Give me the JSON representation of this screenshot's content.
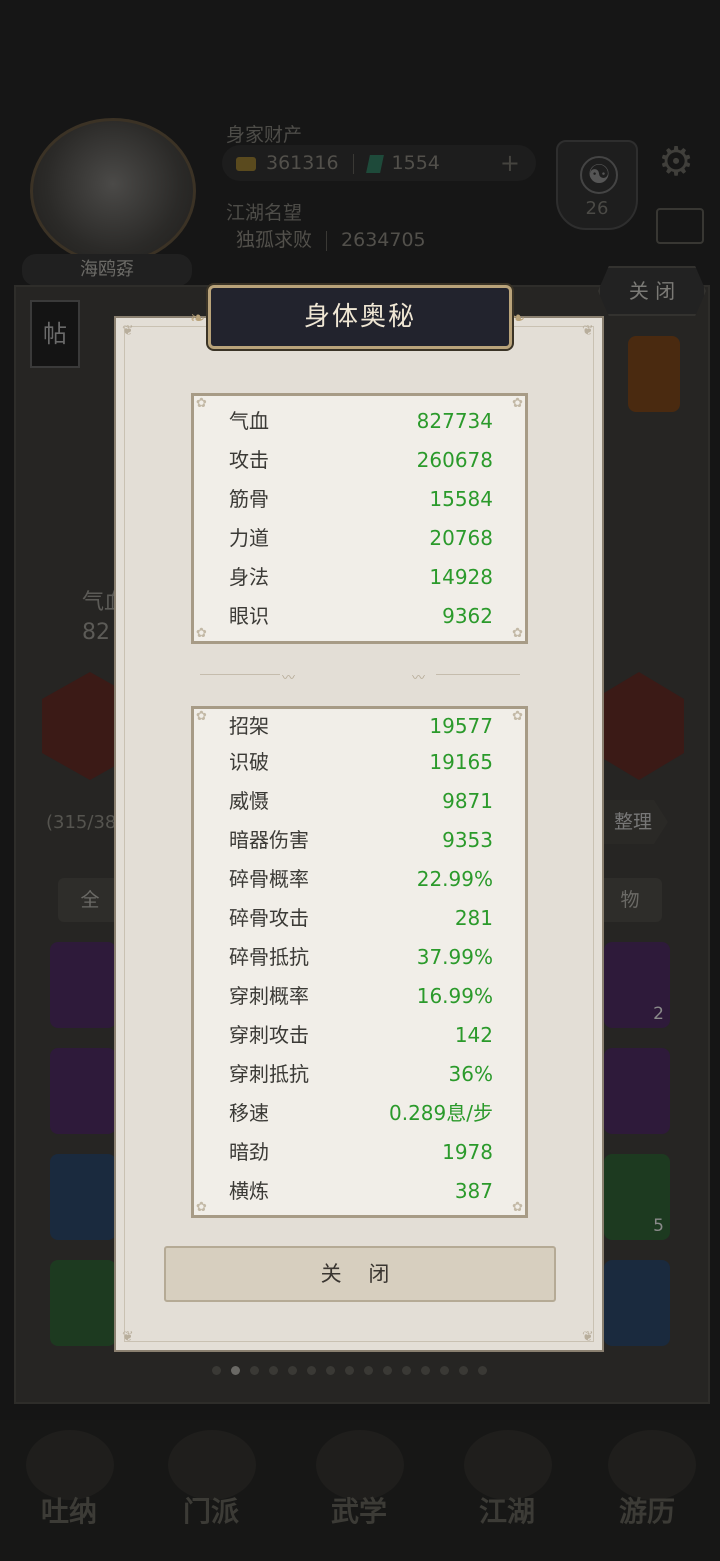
{
  "background": {
    "player_name": "海鸥孬",
    "wealth_label": "身家财产",
    "gold": "361316",
    "jade": "1554",
    "fame_label": "江湖名望",
    "title": "独孤求败",
    "fame_value": "2634705",
    "taiji_level": "26",
    "close_label": "关 闭",
    "post_label": "帖",
    "stat_label": "气血",
    "stat_value": "82",
    "capacity": "(315/38",
    "tidy_label": "整理",
    "filter_all": "全",
    "filter_item": "物",
    "slot_counts": [
      "2",
      "5"
    ],
    "nav": [
      "吐纳",
      "门派",
      "武学",
      "江湖",
      "游历"
    ]
  },
  "dialog": {
    "title": "身体奥秘",
    "close_label": "关 闭",
    "basic_stats": [
      {
        "name": "气血",
        "value": "827734"
      },
      {
        "name": "攻击",
        "value": "260678"
      },
      {
        "name": "筋骨",
        "value": "15584"
      },
      {
        "name": "力道",
        "value": "20768"
      },
      {
        "name": "身法",
        "value": "14928"
      },
      {
        "name": "眼识",
        "value": "9362"
      }
    ],
    "advanced_stats": [
      {
        "name": "招架",
        "value": "19577"
      },
      {
        "name": "识破",
        "value": "19165"
      },
      {
        "name": "威慑",
        "value": "9871"
      },
      {
        "name": "暗器伤害",
        "value": "9353"
      },
      {
        "name": "碎骨概率",
        "value": "22.99%"
      },
      {
        "name": "碎骨攻击",
        "value": "281"
      },
      {
        "name": "碎骨抵抗",
        "value": "37.99%"
      },
      {
        "name": "穿刺概率",
        "value": "16.99%"
      },
      {
        "name": "穿刺攻击",
        "value": "142"
      },
      {
        "name": "穿刺抵抗",
        "value": "36%"
      },
      {
        "name": "移速",
        "value": "0.289息/步"
      },
      {
        "name": "暗劲",
        "value": "1978"
      },
      {
        "name": "横炼",
        "value": "387"
      }
    ]
  },
  "colors": {
    "value_green": "#2b9a2b",
    "label_dark": "#3b3a36",
    "title_plate": "#22232d",
    "panel_bg": "#e3ded6"
  }
}
